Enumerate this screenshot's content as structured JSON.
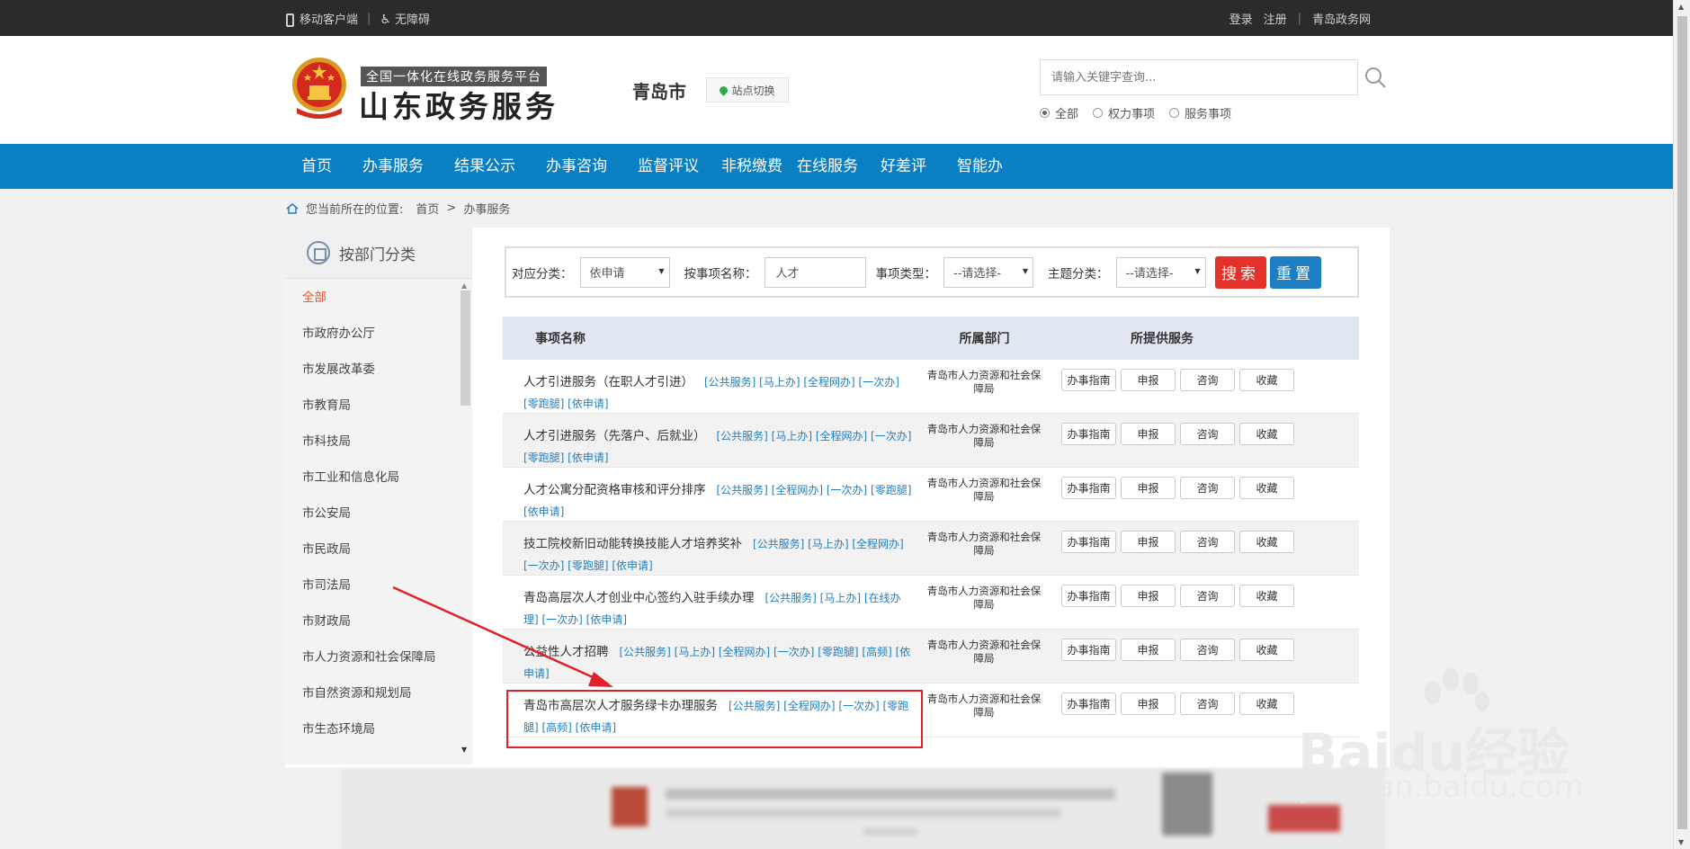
{
  "topbar": {
    "mobile_client": "移动客户端",
    "accessibility": "无障碍",
    "login": "登录",
    "register": "注册",
    "site_link": "青岛政务网"
  },
  "header": {
    "logo_sub": "全国一体化在线政务服务平台",
    "logo_main": "山东政务服务",
    "city": "青岛市",
    "site_switch": "站点切换",
    "search_placeholder": "请输入关键字查询...",
    "radios": [
      {
        "label": "全部",
        "checked": true
      },
      {
        "label": "权力事项",
        "checked": false
      },
      {
        "label": "服务事项",
        "checked": false
      }
    ]
  },
  "nav": [
    "首页",
    "办事服务",
    "结果公示",
    "办事咨询",
    "监督评议",
    "非税缴费",
    "在线服务",
    "好差评",
    "智能办"
  ],
  "breadcrumb": {
    "prefix": "您当前所在的位置:",
    "home": "首页",
    "sep": ">",
    "current": "办事服务"
  },
  "sidebar": {
    "title": "按部门分类",
    "items": [
      "全部",
      "市政府办公厅",
      "市发展改革委",
      "市教育局",
      "市科技局",
      "市工业和信息化局",
      "市公安局",
      "市民政局",
      "市司法局",
      "市财政局",
      "市人力资源和社会保障局",
      "市自然资源和规划局",
      "市生态环境局"
    ]
  },
  "filter": {
    "category_label": "对应分类：",
    "category_value": "依申请",
    "name_label": "按事项名称：",
    "name_value": "人才",
    "type_label": "事项类型：",
    "type_value": "--请选择-",
    "topic_label": "主题分类：",
    "topic_value": "--请选择-",
    "search_btn": "搜索",
    "reset_btn": "重置"
  },
  "table": {
    "headers": [
      "事项名称",
      "所属部门",
      "所提供服务"
    ],
    "button_labels": [
      "办事指南",
      "申报",
      "咨询",
      "收藏"
    ],
    "rows": [
      {
        "name": "人才引进服务（在职人才引进）",
        "tags": "[公共服务] [马上办] [全程网办] [一次办] [零跑腿] [依申请]",
        "dept": "青岛市人力资源和社会保障局"
      },
      {
        "name": "人才引进服务（先落户、后就业）",
        "tags": "[公共服务] [马上办] [全程网办] [一次办] [零跑腿] [依申请]",
        "dept": "青岛市人力资源和社会保障局"
      },
      {
        "name": "人才公寓分配资格审核和评分排序",
        "tags": "[公共服务] [全程网办] [一次办] [零跑腿] [依申请]",
        "dept": "青岛市人力资源和社会保障局"
      },
      {
        "name": "技工院校新旧动能转换技能人才培养奖补",
        "tags": "[公共服务] [马上办] [全程网办] [一次办] [零跑腿] [依申请]",
        "dept": "青岛市人力资源和社会保障局"
      },
      {
        "name": "青岛高层次人才创业中心签约入驻手续办理",
        "tags": "[公共服务] [马上办] [在线办理] [一次办] [依申请]",
        "dept": "青岛市人力资源和社会保障局"
      },
      {
        "name": "公益性人才招聘",
        "tags": "[公共服务] [马上办] [全程网办] [一次办] [零跑腿] [高频] [依申请]",
        "dept": "青岛市人力资源和社会保障局"
      },
      {
        "name": "青岛市高层次人才服务绿卡办理服务",
        "tags": "[公共服务] [全程网办] [一次办] [零跑腿] [高频] [依申请]",
        "dept": "青岛市人力资源和社会保障局"
      }
    ]
  },
  "watermark": {
    "brand": "Baidu经验",
    "url": "jingyan.baidu.com"
  },
  "colors": {
    "nav_blue": "#0a7fc4",
    "search_red": "#e4322b",
    "reset_blue": "#1d7fc3",
    "tag_blue": "#1d7fc3",
    "active_orange": "#e8532b",
    "annotation_red": "#e0202a"
  }
}
